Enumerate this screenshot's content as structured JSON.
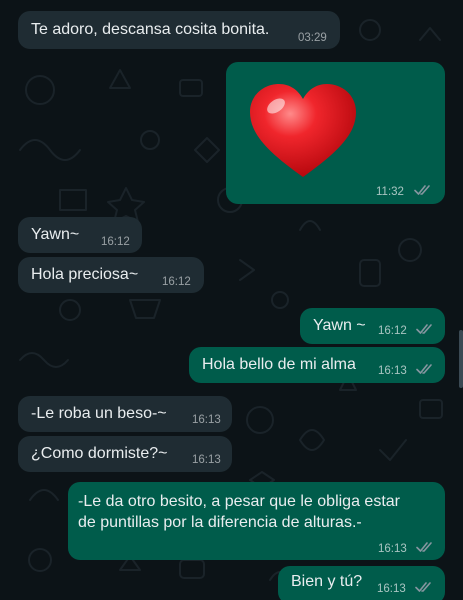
{
  "colors": {
    "background": "#0c1317",
    "incoming_bubble": "#1f2c33",
    "outgoing_bubble": "#005c4b",
    "read_ticks": "#8696a0"
  },
  "messages": [
    {
      "direction": "incoming",
      "text": "Te adoro, descansa cosita bonita.",
      "time": "03:29"
    },
    {
      "direction": "outgoing",
      "type": "emoji",
      "emoji": "red-heart",
      "time": "11:32",
      "status": "read"
    },
    {
      "direction": "incoming",
      "text": "Yawn~",
      "time": "16:12"
    },
    {
      "direction": "incoming",
      "text": "Hola preciosa~",
      "time": "16:12"
    },
    {
      "direction": "outgoing",
      "text": "Yawn ~",
      "time": "16:12",
      "status": "read"
    },
    {
      "direction": "outgoing",
      "text": "Hola bello de mi alma",
      "time": "16:13",
      "status": "read"
    },
    {
      "direction": "incoming",
      "text": "-Le roba un beso-~",
      "time": "16:13"
    },
    {
      "direction": "incoming",
      "text": "¿Como dormiste?~",
      "time": "16:13"
    },
    {
      "direction": "outgoing",
      "text": "-Le da otro besito, a pesar que le obliga estar\nde puntillas por la diferencia de alturas.-",
      "time": "16:13",
      "status": "read"
    },
    {
      "direction": "outgoing",
      "text": "Bien y tú?",
      "time": "16:13",
      "status": "read"
    }
  ]
}
